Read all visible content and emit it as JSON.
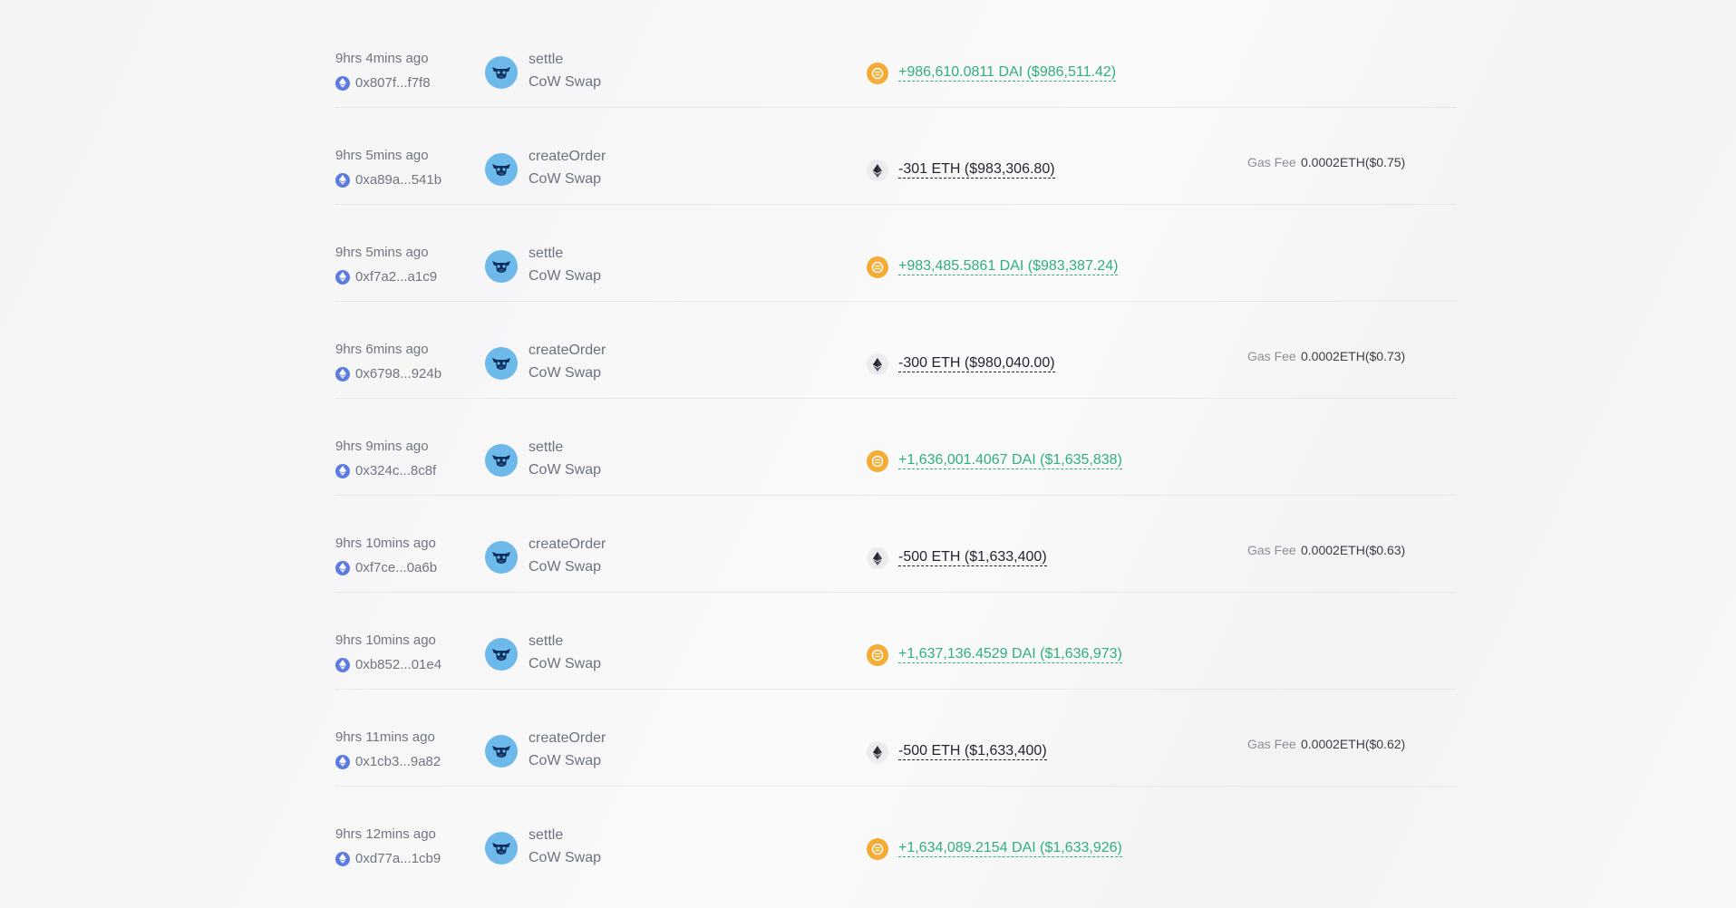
{
  "colors": {
    "positive": "#2fb07c",
    "negative": "#1f2430",
    "eth_badge": "#5c7be0",
    "cow_badge": "#6cb9ea",
    "dai": "#f5ac37"
  },
  "rows": [
    {
      "time": "9hrs 4mins ago",
      "hash": "0x807f...f7f8",
      "method": "settle",
      "dex": "CoW Swap",
      "token": "dai-icon",
      "amount": "+986,610.0811 DAI ($986,511.42)",
      "sign": "pos",
      "gas_label": "",
      "gas_value": ""
    },
    {
      "time": "9hrs 5mins ago",
      "hash": "0xa89a...541b",
      "method": "createOrder",
      "dex": "CoW Swap",
      "token": "eth-icon",
      "amount": "-301 ETH ($983,306.80)",
      "sign": "neg",
      "gas_label": "Gas Fee",
      "gas_value": "0.0002ETH($0.75)"
    },
    {
      "time": "9hrs 5mins ago",
      "hash": "0xf7a2...a1c9",
      "method": "settle",
      "dex": "CoW Swap",
      "token": "dai-icon",
      "amount": "+983,485.5861 DAI ($983,387.24)",
      "sign": "pos",
      "gas_label": "",
      "gas_value": ""
    },
    {
      "time": "9hrs 6mins ago",
      "hash": "0x6798...924b",
      "method": "createOrder",
      "dex": "CoW Swap",
      "token": "eth-icon",
      "amount": "-300 ETH ($980,040.00)",
      "sign": "neg",
      "gas_label": "Gas Fee",
      "gas_value": "0.0002ETH($0.73)"
    },
    {
      "time": "9hrs 9mins ago",
      "hash": "0x324c...8c8f",
      "method": "settle",
      "dex": "CoW Swap",
      "token": "dai-icon",
      "amount": "+1,636,001.4067 DAI ($1,635,838)",
      "sign": "pos",
      "gas_label": "",
      "gas_value": ""
    },
    {
      "time": "9hrs 10mins ago",
      "hash": "0xf7ce...0a6b",
      "method": "createOrder",
      "dex": "CoW Swap",
      "token": "eth-icon",
      "amount": "-500 ETH ($1,633,400)",
      "sign": "neg",
      "gas_label": "Gas Fee",
      "gas_value": "0.0002ETH($0.63)"
    },
    {
      "time": "9hrs 10mins ago",
      "hash": "0xb852...01e4",
      "method": "settle",
      "dex": "CoW Swap",
      "token": "dai-icon",
      "amount": "+1,637,136.4529 DAI ($1,636,973)",
      "sign": "pos",
      "gas_label": "",
      "gas_value": ""
    },
    {
      "time": "9hrs 11mins ago",
      "hash": "0x1cb3...9a82",
      "method": "createOrder",
      "dex": "CoW Swap",
      "token": "eth-icon",
      "amount": "-500 ETH ($1,633,400)",
      "sign": "neg",
      "gas_label": "Gas Fee",
      "gas_value": "0.0002ETH($0.62)"
    },
    {
      "time": "9hrs 12mins ago",
      "hash": "0xd77a...1cb9",
      "method": "settle",
      "dex": "CoW Swap",
      "token": "dai-icon",
      "amount": "+1,634,089.2154 DAI ($1,633,926)",
      "sign": "pos",
      "gas_label": "",
      "gas_value": ""
    }
  ]
}
